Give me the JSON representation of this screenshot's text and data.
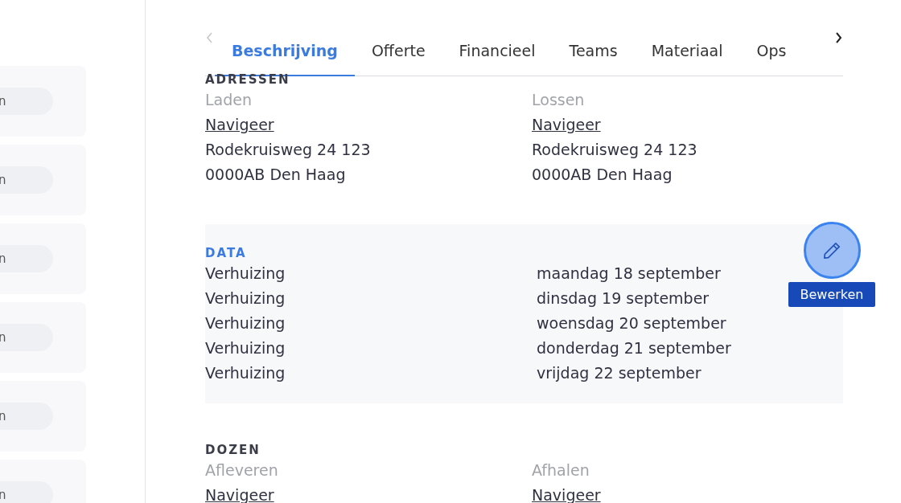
{
  "sidebar": {
    "cards": [
      {
        "pill": "n"
      },
      {
        "pill": "n"
      },
      {
        "pill": "n"
      },
      {
        "pill": "n"
      },
      {
        "pill": "n"
      },
      {
        "pill": "n"
      }
    ]
  },
  "tabs": [
    {
      "label": "Beschrijving",
      "selected": true
    },
    {
      "label": "Offerte",
      "selected": false
    },
    {
      "label": "Financieel",
      "selected": false
    },
    {
      "label": "Teams",
      "selected": false
    },
    {
      "label": "Materiaal",
      "selected": false
    },
    {
      "label": "Ops",
      "selected": false
    }
  ],
  "addresses": {
    "heading": "ADRESSEN",
    "columns": [
      {
        "label": "Laden",
        "link": "Navigeer",
        "street": "Rodekruisweg 24 123",
        "city": "0000AB Den Haag"
      },
      {
        "label": "Lossen",
        "link": "Navigeer",
        "street": "Rodekruisweg 24 123",
        "city": "0000AB Den Haag"
      }
    ]
  },
  "data": {
    "heading": "DATA",
    "rows": [
      {
        "type": "Verhuizing",
        "date": "maandag 18 september"
      },
      {
        "type": "Verhuizing",
        "date": "dinsdag 19 september"
      },
      {
        "type": "Verhuizing",
        "date": "woensdag 20 september"
      },
      {
        "type": "Verhuizing",
        "date": "donderdag 21 september"
      },
      {
        "type": "Verhuizing",
        "date": "vrijdag 22 september"
      }
    ]
  },
  "boxes": {
    "heading": "DOZEN",
    "columns": [
      {
        "label": "Afleveren",
        "link": "Navigeer"
      },
      {
        "label": "Afhalen",
        "link": "Navigeer"
      }
    ]
  },
  "edit_button": {
    "label": "Bewerken"
  }
}
